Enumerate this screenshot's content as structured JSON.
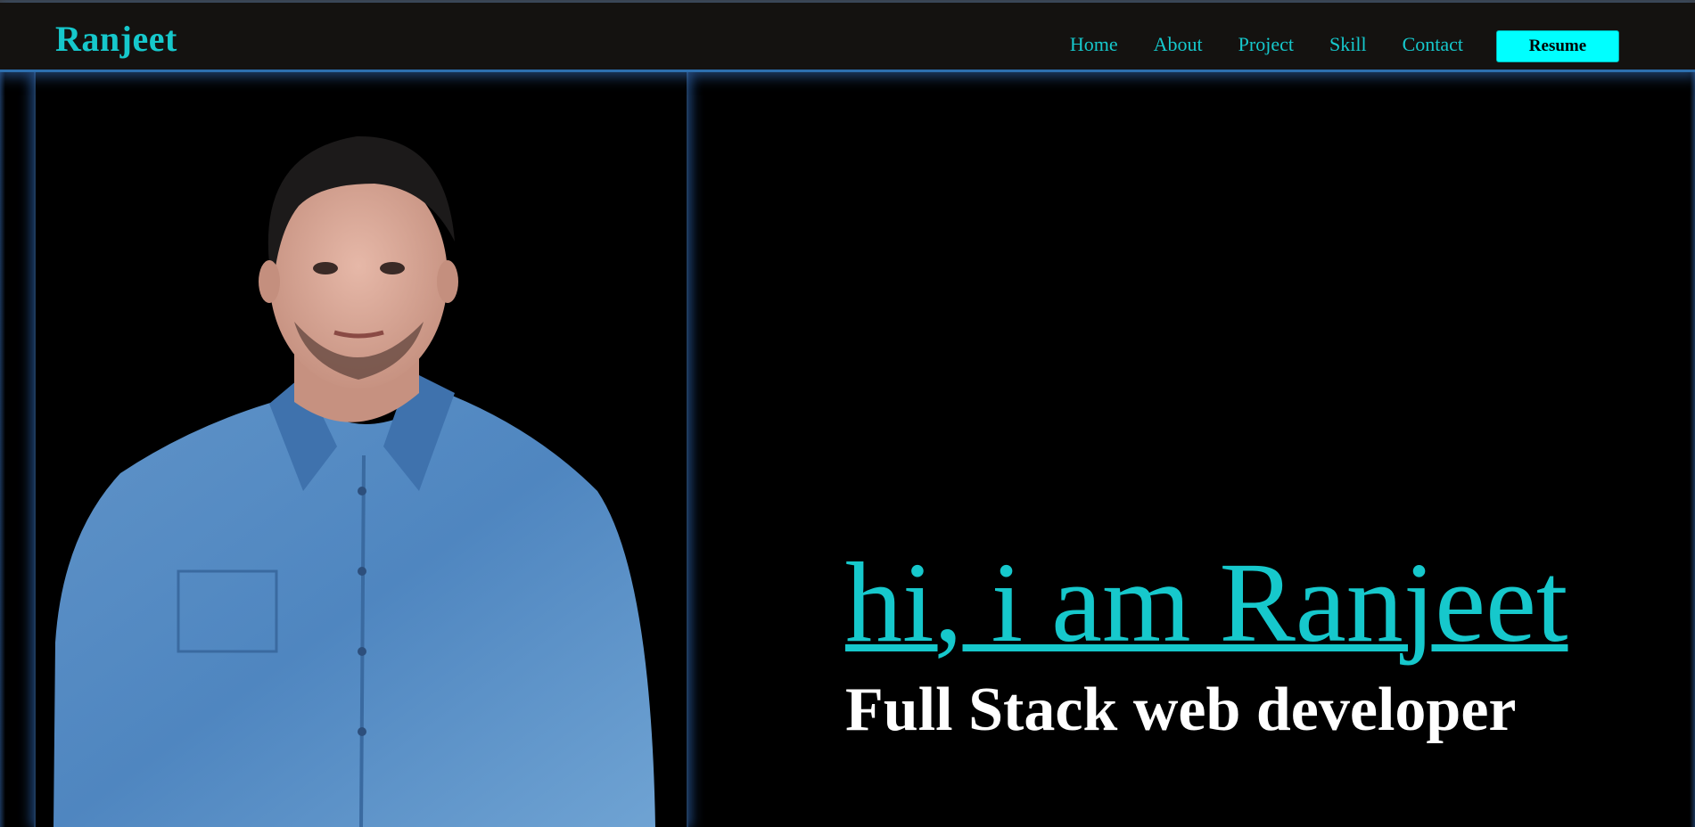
{
  "header": {
    "logo": "Ranjeet",
    "nav": [
      {
        "label": "Home"
      },
      {
        "label": "About"
      },
      {
        "label": "Project"
      },
      {
        "label": "Skill"
      },
      {
        "label": "Contact"
      }
    ],
    "resume_label": "Resume"
  },
  "hero": {
    "title": "hi, i am Ranjeet",
    "subtitle": "Full Stack web developer"
  },
  "colors": {
    "accent": "#16c8cc",
    "button_bg": "#00ffff",
    "navbar_bg": "#141210",
    "glow": "#2d6fae",
    "background": "#000000"
  }
}
